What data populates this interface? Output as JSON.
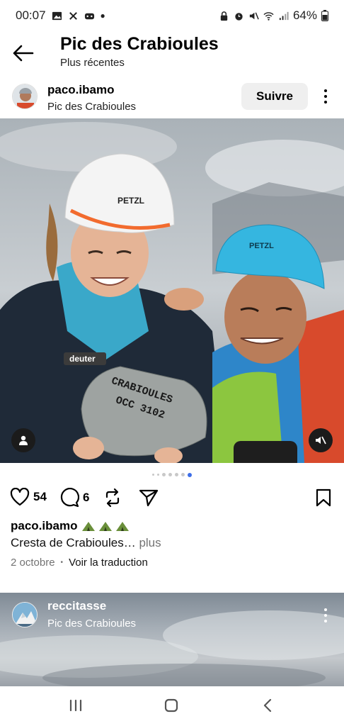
{
  "status_bar": {
    "time": "00:07",
    "battery": "64%"
  },
  "header": {
    "title": "Pic des Crabioules",
    "subtitle": "Plus récentes",
    "back_icon": "arrow-left-icon"
  },
  "post": {
    "username": "paco.ibamo",
    "location": "Pic des Crabioules",
    "follow_label": "Suivre",
    "likes": "54",
    "comments": "6",
    "caption_user": "paco.ibamo",
    "caption_emojis": [
      "⛺",
      "⛺",
      "⛺"
    ],
    "caption_text": "Cresta de Crabioules…",
    "caption_more": "plus",
    "date": "2 octobre",
    "translate_label": "Voir la traduction",
    "carousel": {
      "count": 7,
      "active_index": 6
    },
    "photo": {
      "helmet_left_brand": "PETZL",
      "helmet_right_brand": "PETZL",
      "pack_brand": "deuter",
      "rock_text_1": "CRABIOULES",
      "rock_text_2": "OCC  3102"
    }
  },
  "next_post": {
    "username": "reccitasse",
    "location": "Pic des Crabioules"
  },
  "colors": {
    "accent": "#3d6ee8",
    "follow_bg": "#efefef",
    "muted": "#737373"
  }
}
